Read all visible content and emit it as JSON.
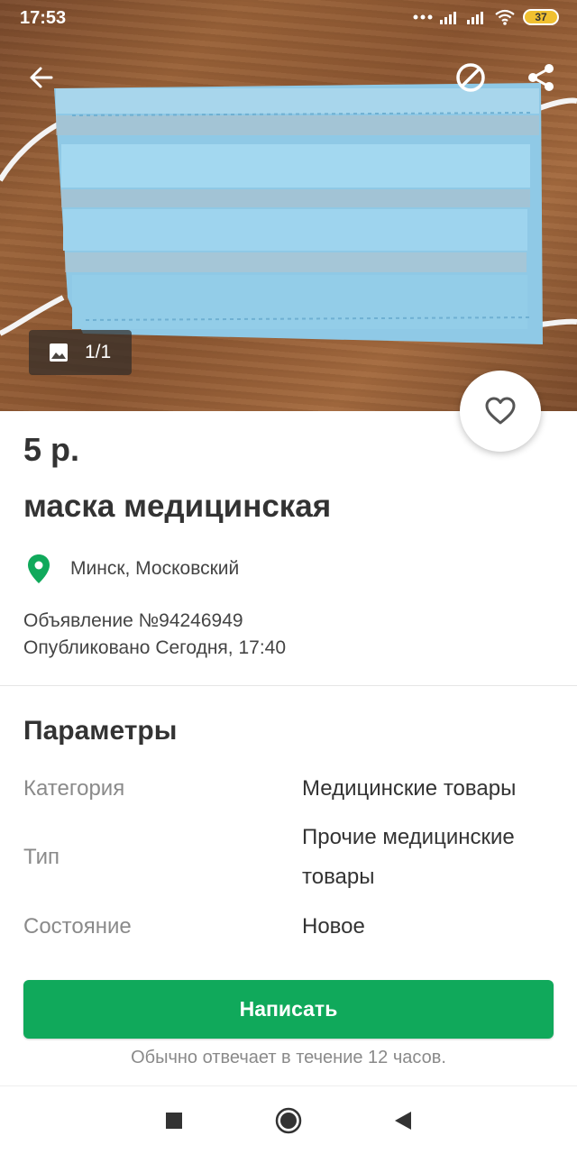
{
  "status_bar": {
    "time": "17:53",
    "battery": "37",
    "icons": [
      "dots-icon",
      "signal-icon",
      "signal-icon",
      "wifi-icon",
      "battery-icon"
    ]
  },
  "toolbar": {
    "back_icon": "arrow-left-icon",
    "block_icon": "block-icon",
    "share_icon": "share-icon"
  },
  "photo": {
    "counter": "1/1",
    "counter_icon": "image-icon"
  },
  "listing": {
    "price": "5 р.",
    "title": "маска медицинская",
    "location": "Минск, Московский",
    "ad_number": "Объявление №94246949",
    "published": "Опубликовано Сегодня, 17:40"
  },
  "params": {
    "heading": "Параметры",
    "rows": [
      {
        "label": "Категория",
        "value": "Медицинские товары"
      },
      {
        "label": "Тип",
        "value": "Прочие медицинские товары"
      },
      {
        "label": "Состояние",
        "value": "Новое"
      }
    ]
  },
  "actions": {
    "write_label": "Написать",
    "reply_note": "Обычно отвечает в течение 12 часов."
  },
  "colors": {
    "accent": "#10a95b",
    "text": "#333333",
    "muted": "#8a8a8a"
  },
  "navbar": {
    "icons": [
      "recent-apps-icon",
      "home-icon",
      "back-triangle-icon"
    ]
  }
}
